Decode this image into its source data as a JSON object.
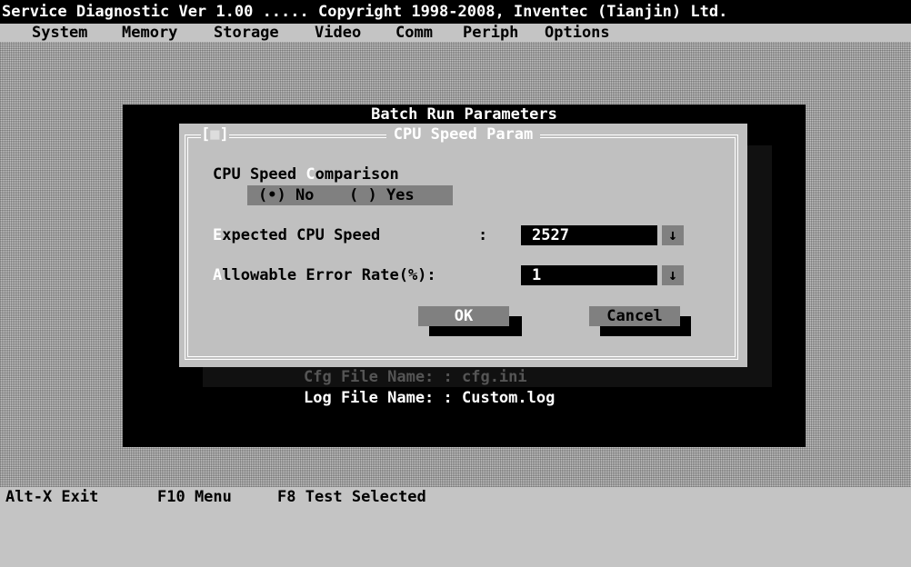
{
  "title_bar": "Service Diagnostic Ver 1.00 ..... Copyright 1998-2008, Inventec (Tianjin) Ltd.",
  "menu": [
    "System",
    "Memory",
    "Storage",
    "Video",
    "Comm",
    "Periph",
    "Options"
  ],
  "batch_window": {
    "title": "Batch Run Parameters",
    "cfg_file_line": "Cfg File Name: : cfg.ini",
    "log_file_line": "Log File Name: : Custom.log"
  },
  "dialog": {
    "title": "CPU Speed Param",
    "close_box_left": "[",
    "close_box_mark": "■",
    "close_box_right": "]",
    "comparison": {
      "label_before": "CPU Speed ",
      "label_hot": "C",
      "label_after": "omparison",
      "options": [
        "(•) No",
        "( ) Yes"
      ],
      "selected": "No"
    },
    "expected": {
      "label_hot": "E",
      "label_rest": "xpected CPU Speed",
      "colon": ":",
      "value": "2527"
    },
    "allowable": {
      "label_hot": "A",
      "label_rest": "llowable Error Rate(%):",
      "value": "1"
    },
    "dropdown_glyph": "↓",
    "ok_label": "OK",
    "cancel_label": "Cancel"
  },
  "status_bar": [
    "Alt-X Exit",
    "F10 Menu",
    "F8 Test Selected"
  ],
  "colors": {
    "background": "#c4c4c4",
    "dialog_bg": "#c0c0c0",
    "button_bg": "#808080",
    "field_bg": "#000000",
    "hotkey": "#ffffff"
  }
}
